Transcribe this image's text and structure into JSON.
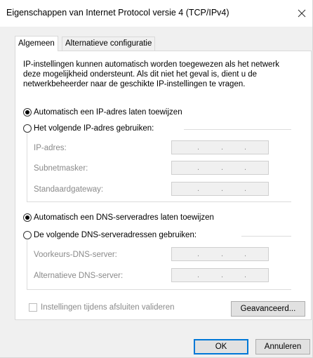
{
  "window": {
    "title": "Eigenschappen van Internet Protocol versie 4 (TCP/IPv4)",
    "close_glyph": "✕"
  },
  "tabs": [
    {
      "label": "Algemeen",
      "active": true
    },
    {
      "label": "Alternatieve configuratie",
      "active": false
    }
  ],
  "intro_text": "IP-instellingen kunnen automatisch worden toegewezen als het netwerk deze mogelijkheid ondersteunt. Als dit niet het geval is, dient u de netwerkbeheerder naar de geschikte IP-instellingen te vragen.",
  "ip_section": {
    "auto_option": "Automatisch een IP-adres laten toewijzen",
    "manual_option": "Het volgende IP-adres gebruiken:",
    "selected": "auto",
    "fields": [
      {
        "label": "IP-adres:",
        "value": ". . ."
      },
      {
        "label": "Subnetmasker:",
        "value": ". . ."
      },
      {
        "label": "Standaardgateway:",
        "value": ". . ."
      }
    ]
  },
  "dns_section": {
    "auto_option": "Automatisch een DNS-serveradres laten toewijzen",
    "manual_option": "De volgende DNS-serveradressen gebruiken:",
    "selected": "auto",
    "fields": [
      {
        "label": "Voorkeurs-DNS-server:",
        "value": ". . ."
      },
      {
        "label": "Alternatieve DNS-server:",
        "value": ". . ."
      }
    ]
  },
  "validate_checkbox": {
    "label": "Instellingen tijdens afsluiten valideren",
    "checked": false,
    "enabled": false
  },
  "buttons": {
    "advanced": "Geavanceerd...",
    "ok": "OK",
    "cancel": "Annuleren"
  },
  "colors": {
    "accent": "#0078d7",
    "disabled_text": "#8a8a8a",
    "dialog_bg": "#f0f0f0"
  }
}
